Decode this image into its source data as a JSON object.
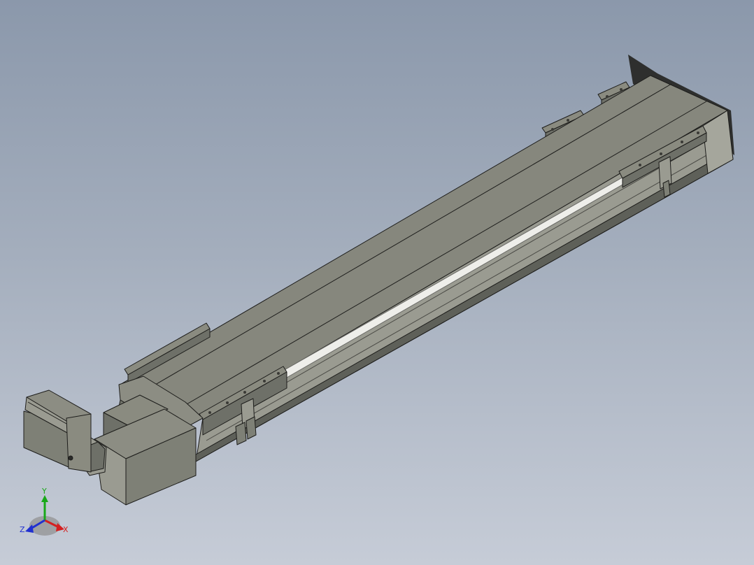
{
  "model": {
    "name": "linear-actuator-module",
    "colors": {
      "background_top": "#8b98ab",
      "background_bottom": "#c6ccd7",
      "body_top": "#86877d",
      "body_side": "#9a9b91",
      "body_dark": "#5e6059",
      "edge": "#1d1d1b",
      "highlight": "#eeeeea",
      "motor": "#7e8076",
      "shadow": "#4a4a48"
    }
  },
  "triad": {
    "x_label": "X",
    "y_label": "Y",
    "z_label": "Z",
    "x_color": "#d42020",
    "y_color": "#18a818",
    "z_color": "#2030d0"
  }
}
